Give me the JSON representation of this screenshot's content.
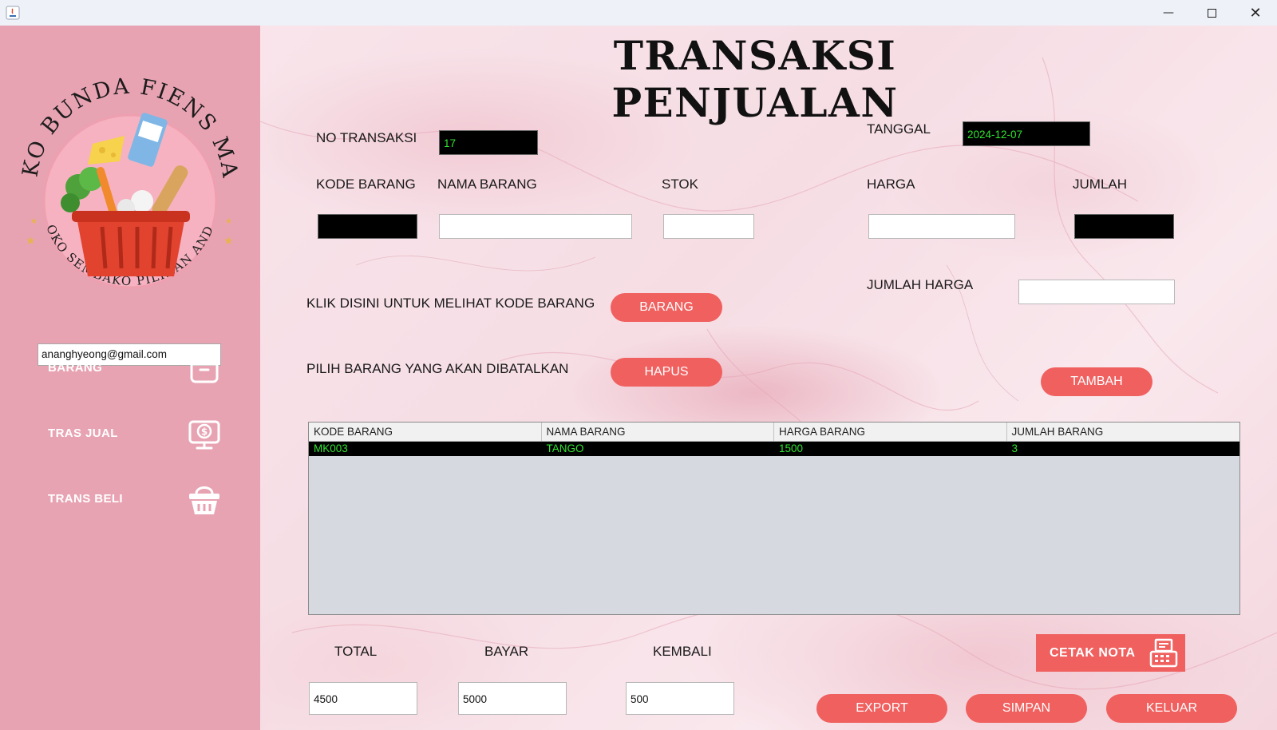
{
  "window": {
    "minimize_glyph": "—",
    "close_glyph": "✕"
  },
  "sidebar": {
    "logo": {
      "top_text": "TOKO BUNDA FIENS MART",
      "bottom_text": "TOKO SEMBAKO PILIHAN ANDA"
    },
    "email": "ananghyeong@gmail.com",
    "items": [
      {
        "label": "BARANG",
        "icon": "archive-box-icon"
      },
      {
        "label": "TRAS JUAL",
        "icon": "money-monitor-icon"
      },
      {
        "label": "TRANS BELI",
        "icon": "basket-icon"
      }
    ]
  },
  "main": {
    "title": "TRANSAKSI PENJUALAN",
    "no_transaksi": {
      "label": "NO TRANSAKSI",
      "value": "17"
    },
    "tanggal": {
      "label": "TANGGAL",
      "value": "2024-12-07"
    },
    "kode_barang": {
      "label": "KODE BARANG",
      "value": ""
    },
    "nama_barang": {
      "label": "NAMA BARANG",
      "value": ""
    },
    "stok": {
      "label": "STOK",
      "value": ""
    },
    "harga": {
      "label": "HARGA",
      "value": ""
    },
    "jumlah": {
      "label": "JUMLAH",
      "value": ""
    },
    "jumlah_harga": {
      "label": "JUMLAH HARGA",
      "value": ""
    },
    "hint_lihat": "KLIK DISINI UNTUK MELIHAT KODE BARANG",
    "hint_batal": "PILIH BARANG YANG AKAN DIBATALKAN",
    "buttons": {
      "barang": "BARANG",
      "hapus": "HAPUS",
      "tambah": "TAMBAH",
      "cetak_nota": "CETAK NOTA",
      "export": "EXPORT",
      "simpan": "SIMPAN",
      "keluar": "KELUAR"
    },
    "table": {
      "columns": [
        "KODE BARANG",
        "NAMA BARANG",
        "HARGA BARANG",
        "JUMLAH BARANG"
      ],
      "rows": [
        [
          "MK003",
          "TANGO",
          "1500",
          "3"
        ]
      ]
    },
    "total": {
      "label": "TOTAL",
      "value": "4500"
    },
    "bayar": {
      "label": "BAYAR",
      "value": "5000"
    },
    "kembali": {
      "label": "KEMBALI",
      "value": "500"
    }
  },
  "colors": {
    "sidebar": "#e8a3b3",
    "accent_button": "#f0605f",
    "dark_field": "#000000",
    "dark_field_text": "#2fe52f"
  }
}
